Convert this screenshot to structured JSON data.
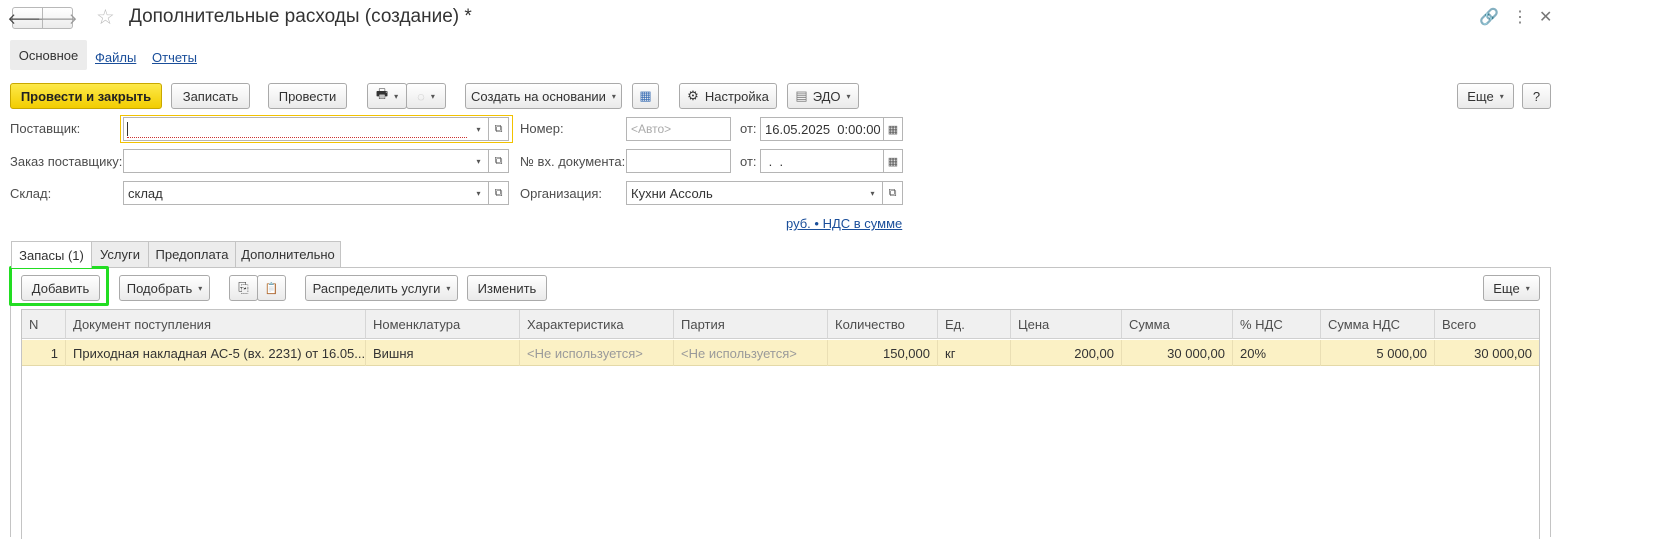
{
  "window": {
    "title": "Дополнительные расходы (создание) *",
    "back_arrow": "🡐",
    "forward_arrow": "🡒",
    "star": "☆",
    "link_icon": "🔗",
    "more_icon": "⋮",
    "close_icon": "✕"
  },
  "section_tabs": [
    "Основное",
    "Файлы",
    "Отчеты"
  ],
  "toolbar": {
    "post_close": "Провести и закрыть",
    "save": "Записать",
    "post": "Провести",
    "create_based": "Создать на основании",
    "settings": "Настройка",
    "edo": "ЭДО",
    "more": "Еще",
    "help": "?",
    "print_icon": "🖶",
    "settings_icon": "⚙",
    "edo_icon": "▤",
    "structure_icon": "▦"
  },
  "form": {
    "supplier_label": "Поставщик:",
    "supplier_value": "",
    "order_label": "Заказ поставщику:",
    "order_value": "",
    "warehouse_label": "Склад:",
    "warehouse_value": "склад",
    "number_label": "Номер:",
    "number_placeholder": "<Авто>",
    "date_from_label": "от:",
    "date_value": "16.05.2025  0:00:00",
    "incoming_doc_label": "№ вх. документа:",
    "incoming_doc_value": "",
    "incoming_date_label": "от:",
    "incoming_date_value": " .  .",
    "org_label": "Организация:",
    "org_value": "Кухни Ассоль",
    "vat_link": "руб. • НДС в сумме",
    "dropdown_glyph": "▾",
    "open_glyph": "⧉",
    "calendar_glyph": "▦"
  },
  "inner_tabs": [
    "Запасы (1)",
    "Услуги",
    "Предоплата",
    "Дополнительно"
  ],
  "table_toolbar": {
    "add": "Добавить",
    "pick": "Подобрать",
    "distribute": "Распределить услуги",
    "change": "Изменить",
    "more": "Еще",
    "copy_icon": "⎘",
    "paste_icon": "📋"
  },
  "table": {
    "columns": [
      "N",
      "Документ поступления",
      "Номенклатура",
      "Характеристика",
      "Партия",
      "Количество",
      "Ед.",
      "Цена",
      "Сумма",
      "% НДС",
      "Сумма НДС",
      "Всего"
    ],
    "rows": [
      {
        "n": "1",
        "doc": "Приходная накладная АС-5 (вх. 2231) от 16.05....",
        "item": "Вишня",
        "characteristic": "<Не используется>",
        "batch": "<Не используется>",
        "qty": "150,000",
        "unit": "кг",
        "price": "200,00",
        "sum": "30 000,00",
        "vat_rate": "20%",
        "vat_sum": "5 000,00",
        "total": "30 000,00"
      }
    ]
  },
  "colors": {
    "primary_button": "#f2cd00",
    "highlight_frame": "#22dd22",
    "selected_row": "#fbf1c5",
    "link": "#1a4e9a"
  }
}
